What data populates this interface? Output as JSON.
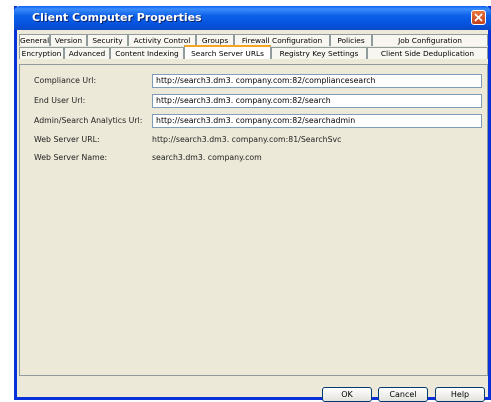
{
  "window": {
    "title": "Client Computer Properties"
  },
  "tabs": {
    "row1": [
      {
        "label": "General"
      },
      {
        "label": "Version"
      },
      {
        "label": "Security"
      },
      {
        "label": "Activity Control"
      },
      {
        "label": "Groups"
      },
      {
        "label": "Firewall Configuration"
      },
      {
        "label": "Policies"
      },
      {
        "label": "Job Configuration"
      }
    ],
    "row2": [
      {
        "label": "Encryption"
      },
      {
        "label": "Advanced"
      },
      {
        "label": "Content Indexing"
      },
      {
        "label": "Search Server URLs"
      },
      {
        "label": "Registry Key Settings"
      },
      {
        "label": "Client Side Deduplication"
      }
    ],
    "active": "Search Server URLs"
  },
  "form": {
    "compliance_label": "Compliance Url:",
    "compliance_value": "http://search3.dm3. company.com:82/compliancesearch",
    "enduser_label": "End User Url:",
    "enduser_value": "http://search3.dm3. company.com:82/search",
    "admin_label": "Admin/Search Analytics Url:",
    "admin_value": "http://search3.dm3. company.com:82/searchadmin",
    "webserver_url_label": "Web Server URL:",
    "webserver_url_value": "http://search3.dm3. company.com:81/SearchSvc",
    "webserver_name_label": "Web Server Name:",
    "webserver_name_value": "search3.dm3. company.com"
  },
  "buttons": {
    "ok": "OK",
    "cancel": "Cancel",
    "help": "Help"
  },
  "colors": {
    "titlebar": "#0553df",
    "active_tab_accent": "#f5a623",
    "dialog_bg": "#ece9d8"
  }
}
